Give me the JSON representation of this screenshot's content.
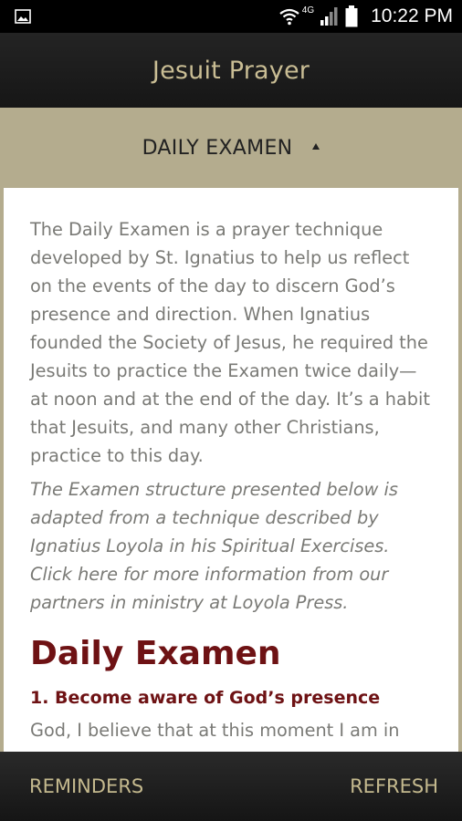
{
  "status_bar": {
    "time": "10:22 PM",
    "network": "4G",
    "icons": [
      "gallery-icon",
      "wifi-icon",
      "signal-icon",
      "battery-icon"
    ]
  },
  "header": {
    "title": "Jesuit Prayer"
  },
  "section": {
    "title": "DAILY EXAMEN",
    "caret": "up"
  },
  "content": {
    "intro": "The Daily Examen is a prayer technique developed by St. Ignatius to help us reflect on the events of the day to discern God’s presence and direction. When Ignatius founded the Society of Jesus, he required the Jesuits to practice the Examen twice daily—at noon and at the end of the day. It’s a habit that Jesuits, and many other Christians, practice to this day.",
    "note": "The Examen structure presented below is adapted from a technique described by Ignatius Loyola in his Spiritual Exercises. Click here for more information from our partners in ministry at Loyola Press.",
    "heading": "Daily Examen",
    "step1_title": "1. Become aware of God’s presence",
    "step1_text": "God, I believe that at this moment I am in"
  },
  "bottom_bar": {
    "reminders_label": "REMINDERS",
    "refresh_label": "REFRESH"
  },
  "colors": {
    "accent_tan": "#b4ac8e",
    "title_gold": "#c9bd94",
    "heading_red": "#6e1214",
    "body_gray": "#7a7a76"
  }
}
